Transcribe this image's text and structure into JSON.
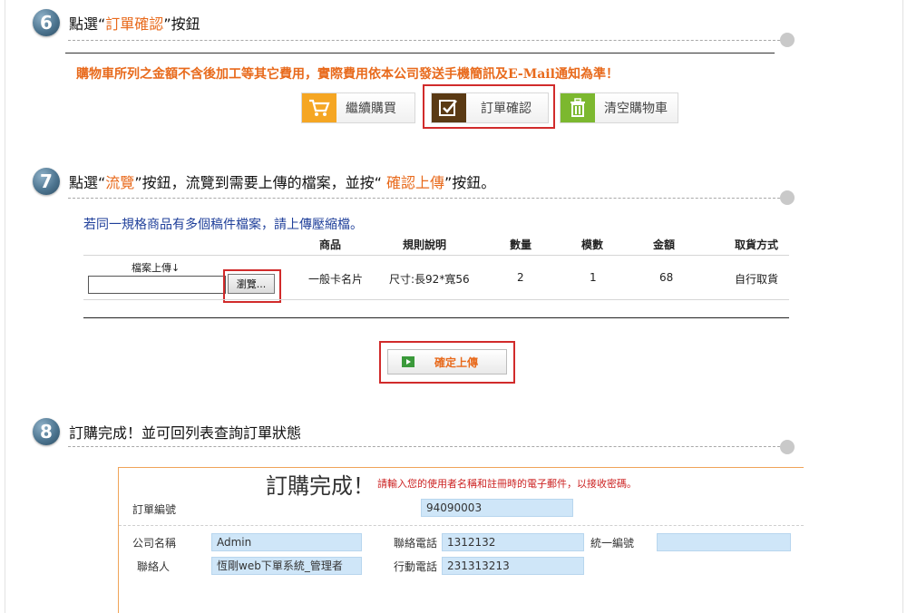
{
  "steps": [
    {
      "num": "6",
      "pre": "點選“",
      "hl": "訂單確認",
      "post": "”按鈕",
      "hl2": "",
      "post2": ""
    },
    {
      "num": "7",
      "pre": "點選“",
      "hl": "流覽",
      "post": "”按鈕，流覽到需要上傳的檔案，並按“ ",
      "hl2": "確認上傳",
      "post2": "”按鈕。"
    },
    {
      "num": "8",
      "pre": "訂購完成！並可回列表查詢訂單狀態",
      "hl": "",
      "post": "",
      "hl2": "",
      "post2": ""
    }
  ],
  "cart": {
    "notice": "購物車所列之金額不含後加工等其它費用，實際費用依本公司發送手機簡訊及E-Mail通知為準！",
    "buttons": {
      "continue": "繼續購買",
      "confirm": "訂單確認",
      "clear": "清空購物車"
    }
  },
  "upload": {
    "hint": "若同一規格商品有多個稿件檔案，請上傳壓縮檔。",
    "headers": [
      "商品",
      "規則說明",
      "數量",
      "模數",
      "金額",
      "取貨方式"
    ],
    "file_label": "檔案上傳↓",
    "browse_label": "瀏覽...",
    "row": {
      "product": "一般卡名片",
      "spec": "尺寸:長92*寬56",
      "qty": "2",
      "modules": "1",
      "amount": "68",
      "pickup": "自行取貨"
    },
    "submit_label": "確定上傳"
  },
  "order": {
    "title": "訂購完成！",
    "note": "請輸入您的使用者名稱和註冊時的電子郵件，以接收密碼。",
    "order_no_label": "訂單編號",
    "order_no": "94090003",
    "company_label": "公司名稱",
    "company": "Admin",
    "phone_label": "聯絡電話",
    "phone": "1312132",
    "tax_label": "統一編號",
    "tax": "",
    "contact_label": "聯絡人",
    "contact": "恆剛web下單系統_管理者",
    "mobile_label": "行動電話",
    "mobile": "231313213"
  },
  "colors": {
    "accent": "#e86a1c",
    "highlight_box": "#d12b2b",
    "field_bg": "#cfe6f8",
    "link_blue": "#1f3f9a"
  }
}
